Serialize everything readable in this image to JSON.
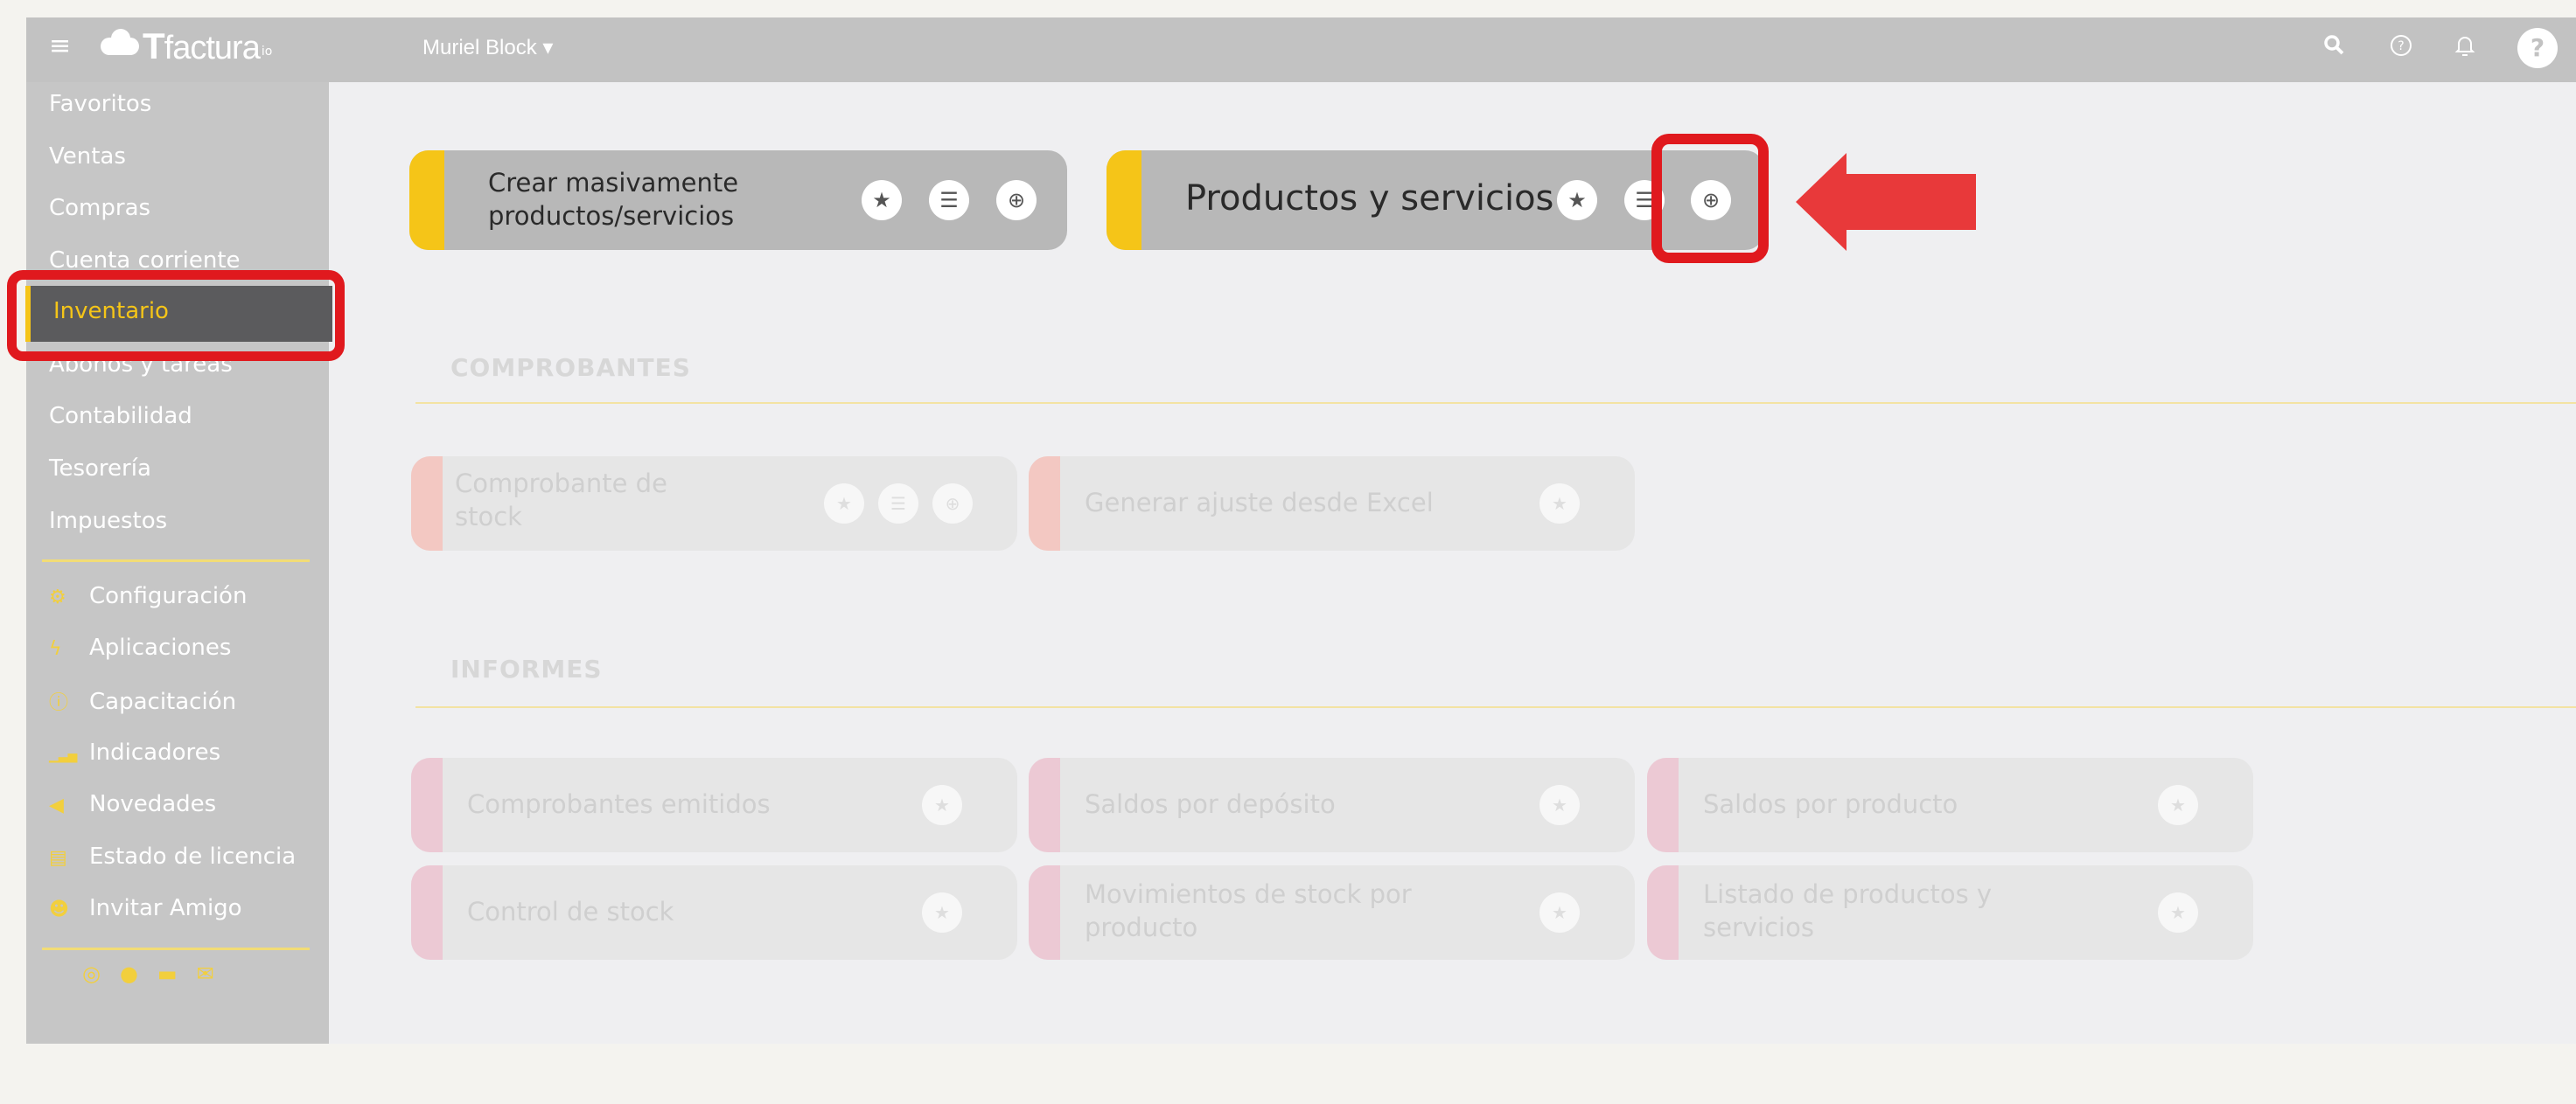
{
  "topbar": {
    "brand": "factura",
    "brand_initial": "T",
    "brand_tld": "io",
    "user_menu": "Muriel Block ▾",
    "icons": [
      "menu-icon",
      "search-icon",
      "help-icon",
      "bell-icon",
      "avatar"
    ]
  },
  "sidebar": {
    "items": [
      {
        "label": "Favoritos"
      },
      {
        "label": "Ventas"
      },
      {
        "label": "Compras"
      },
      {
        "label": "Cuenta corriente"
      },
      {
        "label": "Inventario",
        "active": true
      },
      {
        "label": "Abonos y tareas"
      },
      {
        "label": "Contabilidad"
      },
      {
        "label": "Tesorería"
      },
      {
        "label": "Impuestos"
      }
    ],
    "tools": [
      {
        "label": "Configuración",
        "icon": "gear-icon",
        "glyph": "⚙"
      },
      {
        "label": "Aplicaciones",
        "icon": "bolt-icon",
        "glyph": "ϟ"
      },
      {
        "label": "Capacitación",
        "icon": "info-icon",
        "glyph": "ⓘ"
      },
      {
        "label": "Indicadores",
        "icon": "bar-chart-icon",
        "glyph": "▁▃▅"
      },
      {
        "label": "Novedades",
        "icon": "megaphone-icon",
        "glyph": "◀"
      },
      {
        "label": "Estado de licencia",
        "icon": "license-icon",
        "glyph": "▤"
      },
      {
        "label": "Invitar Amigo",
        "icon": "add-user-icon",
        "glyph": "☻"
      }
    ],
    "socials": [
      "instagram-icon",
      "facebook-icon",
      "youtube-icon",
      "mail-icon"
    ]
  },
  "main": {
    "featured": [
      {
        "label_line1": "Crear masivamente",
        "label_line2": "productos/servicios"
      },
      {
        "label": "Productos y servicios"
      }
    ],
    "sections": [
      {
        "title": "COMPROBANTES",
        "cards": [
          {
            "label_line1": "Comprobante de",
            "label_line2": "stock"
          },
          {
            "label": "Generar ajuste desde Excel"
          }
        ]
      },
      {
        "title": "INFORMES",
        "cards": [
          {
            "label": "Comprobantes emitidos"
          },
          {
            "label": "Saldos por depósito"
          },
          {
            "label": "Saldos por producto"
          },
          {
            "label": "Control de stock"
          },
          {
            "label_line1": "Movimientos de stock por",
            "label_line2": "producto"
          },
          {
            "label_line1": "Listado de productos y",
            "label_line2": "servicios"
          }
        ]
      }
    ]
  },
  "colors": {
    "accent": "#f5c518",
    "highlight": "#e0191e",
    "topbar": "#c2c2c2",
    "sidebar": "#c6c6c6"
  }
}
